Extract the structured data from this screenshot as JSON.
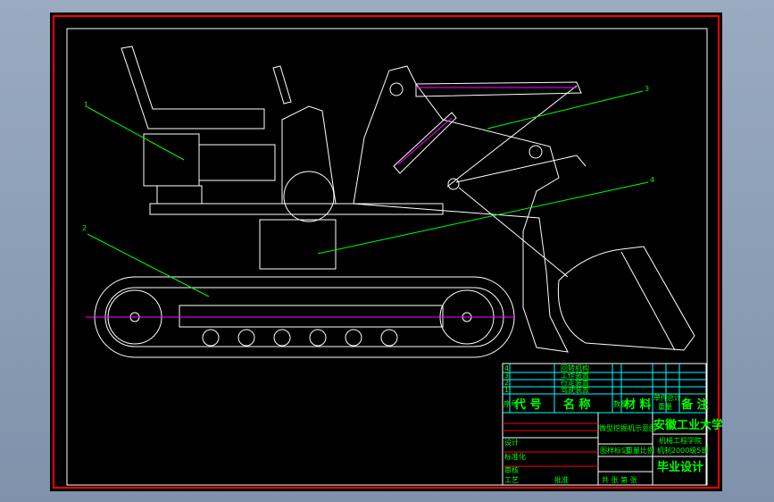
{
  "colors": {
    "frame": "#ff0000",
    "lines": "#ffffff",
    "leaders": "#00ff00",
    "table": "#00ffff",
    "centerline": "#ff00ff"
  },
  "callouts": [
    "1",
    "2",
    "3",
    "4"
  ],
  "parts_list": [
    {
      "no": "4",
      "name": "回转机构"
    },
    {
      "no": "3",
      "name": "工作装置"
    },
    {
      "no": "2",
      "name": "行走装置"
    },
    {
      "no": "1",
      "name": "驾驶装置"
    }
  ],
  "header": {
    "seq": "序号",
    "code": "代 号",
    "name": "名 称",
    "qty": "数量",
    "material": "材 料",
    "unit": "单件",
    "total": "总计",
    "weight": "重量",
    "remark": "备 注"
  },
  "title_block": {
    "drawing_title": "微型挖掘机示意图",
    "school": "安徽工业大学",
    "college": "机械工程学院",
    "class": "机制2000级5班",
    "type": "毕业设计",
    "stage_mark": "图样标记",
    "weight": "重量",
    "scale": "比例",
    "sheet_info": "共 张 第 张",
    "design": "设计",
    "standard": "标准化",
    "check": "审核",
    "process": "工艺",
    "approve": "批准"
  }
}
